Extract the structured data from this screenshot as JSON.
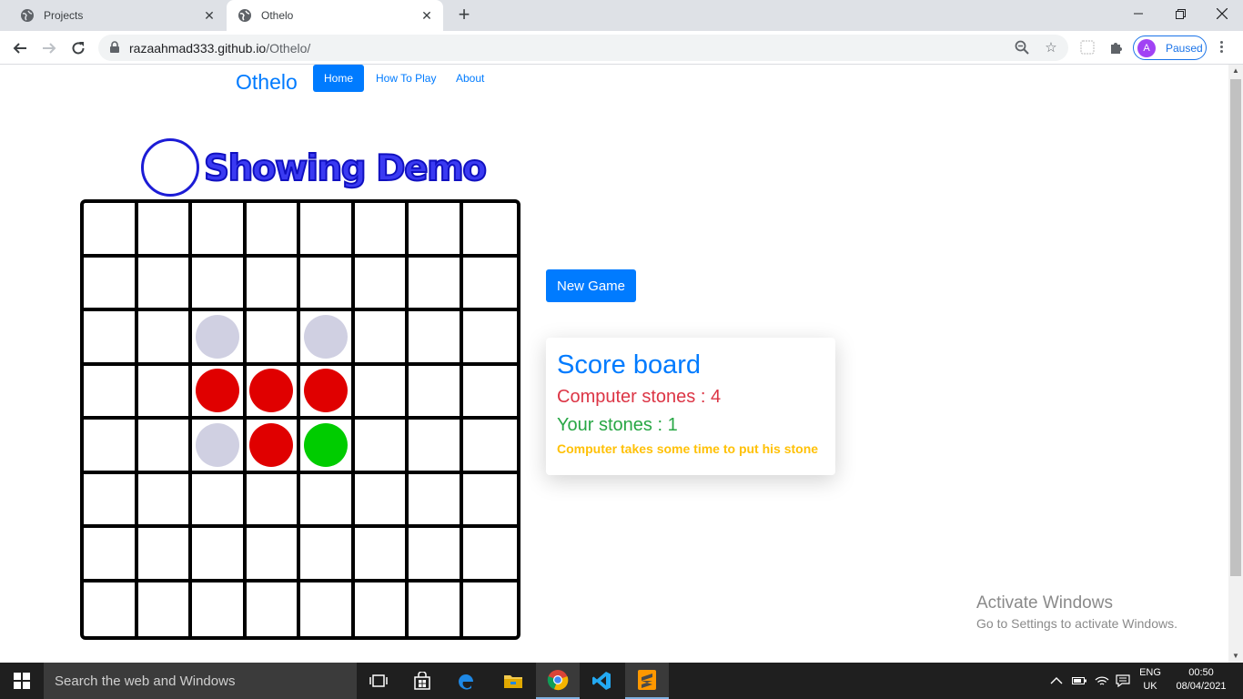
{
  "browser": {
    "tabs": [
      {
        "title": "Projects",
        "active": false
      },
      {
        "title": "Othelo",
        "active": true
      }
    ],
    "url_host": "razaahmad333.github.io",
    "url_path": "/Othelo/",
    "profile_initial": "A",
    "profile_status": "Paused"
  },
  "nav": {
    "brand": "Othelo",
    "links": [
      "Home",
      "How To Play",
      "About"
    ],
    "active_link": "Home"
  },
  "game": {
    "demo_heading": "Showing Demo",
    "board_size": 8,
    "board": [
      [
        "",
        "",
        "",
        "",
        "",
        "",
        "",
        ""
      ],
      [
        "",
        "",
        "",
        "",
        "",
        "",
        "",
        ""
      ],
      [
        "",
        "",
        "hint",
        "",
        "hint",
        "",
        "",
        ""
      ],
      [
        "",
        "",
        "red",
        "red",
        "red",
        "",
        "",
        ""
      ],
      [
        "",
        "",
        "hint",
        "red",
        "green",
        "",
        "",
        ""
      ],
      [
        "",
        "",
        "",
        "",
        "",
        "",
        "",
        ""
      ],
      [
        "",
        "",
        "",
        "",
        "",
        "",
        "",
        ""
      ],
      [
        "",
        "",
        "",
        "",
        "",
        "",
        "",
        ""
      ]
    ],
    "stone_colors": {
      "red": "#e00000",
      "green": "#00cc00",
      "hint": "#d0d0e2"
    },
    "new_game_label": "New Game"
  },
  "scoreboard": {
    "title": "Score board",
    "computer_stones": "Computer stones : 4",
    "your_stones": "Your stones : 1",
    "note": "Computer takes some time to put his stone"
  },
  "watermark": {
    "title": "Activate Windows",
    "subtitle": "Go to Settings to activate Windows."
  },
  "taskbar": {
    "search_placeholder": "Search the web and Windows",
    "language": "ENG",
    "region": "UK",
    "time": "00:50",
    "date": "08/04/2021"
  },
  "colors": {
    "primary": "#007bff",
    "danger": "#dc3545",
    "success": "#28a745",
    "warning": "#ffc107"
  }
}
